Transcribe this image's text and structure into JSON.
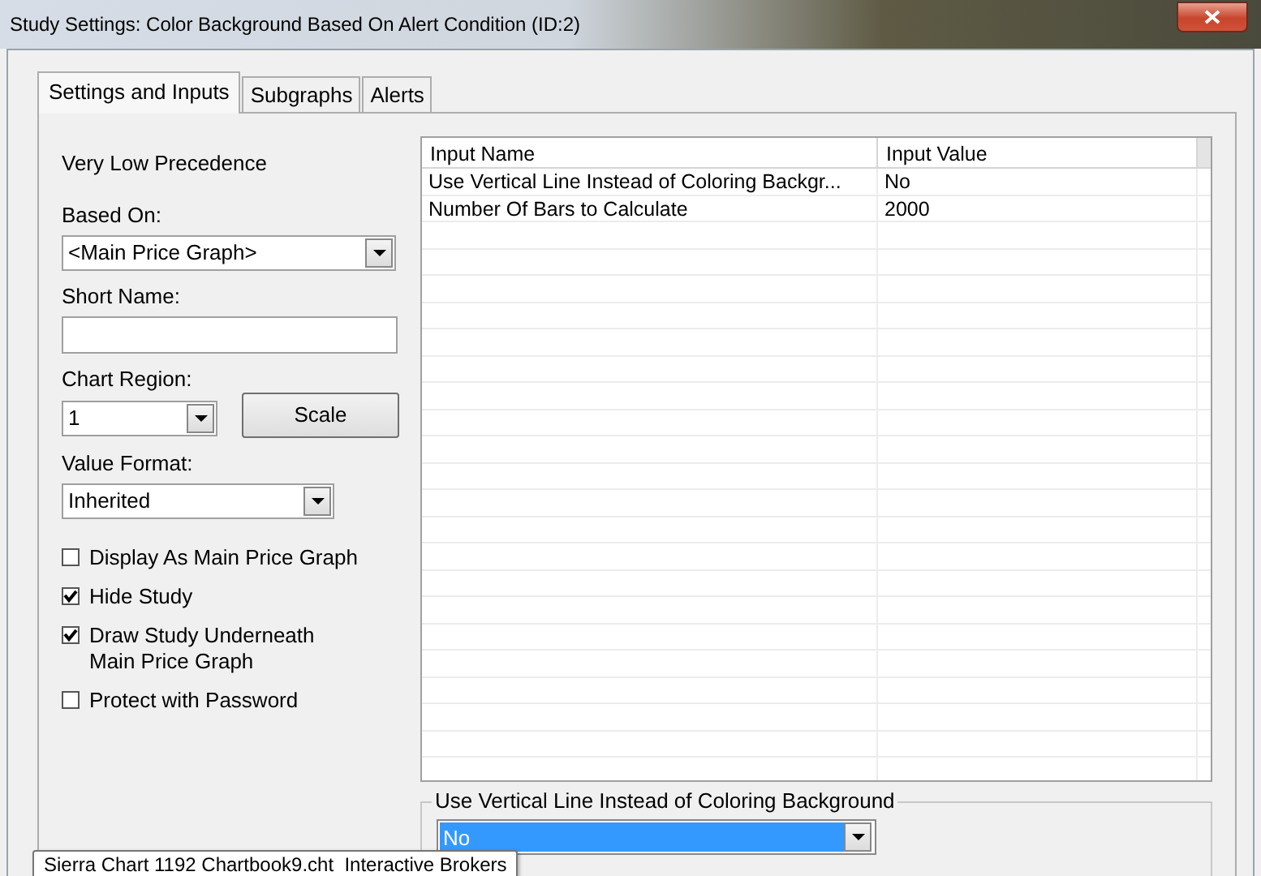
{
  "window": {
    "title": "Study Settings: Color Background Based On Alert Condition (ID:2)"
  },
  "tabs": [
    {
      "label": "Settings and Inputs",
      "selected": true
    },
    {
      "label": "Subgraphs",
      "selected": false
    },
    {
      "label": "Alerts",
      "selected": false
    }
  ],
  "settings": {
    "precedence": "Very Low Precedence",
    "based_on": {
      "label": "Based On:",
      "value": "<Main Price Graph>"
    },
    "short_name": {
      "label": "Short Name:"
    },
    "chart_region": {
      "label": "Chart Region:",
      "value": "1"
    },
    "scale_button": "Scale",
    "value_format": {
      "label": "Value Format:",
      "value": "Inherited"
    },
    "options": [
      {
        "label": "Display As Main Price Graph",
        "checked": false
      },
      {
        "label": "Hide Study",
        "checked": true
      },
      {
        "label": "Draw Study Underneath\nMain Price Graph",
        "checked": true
      },
      {
        "label": "Protect with Password",
        "checked": false
      }
    ]
  },
  "inputs": {
    "columns": [
      "Input Name",
      "Input Value"
    ],
    "rows": [
      {
        "name": "Use Vertical Line Instead of Coloring Backgr...",
        "value": "No"
      },
      {
        "name": "Number Of Bars to Calculate",
        "value": "2000"
      }
    ]
  },
  "input_editor": {
    "label": "Use Vertical Line Instead of Coloring Background",
    "value": "No"
  },
  "tooltip": "Sierra Chart 1192 Chartbook9.cht  Interactive Brokers"
}
